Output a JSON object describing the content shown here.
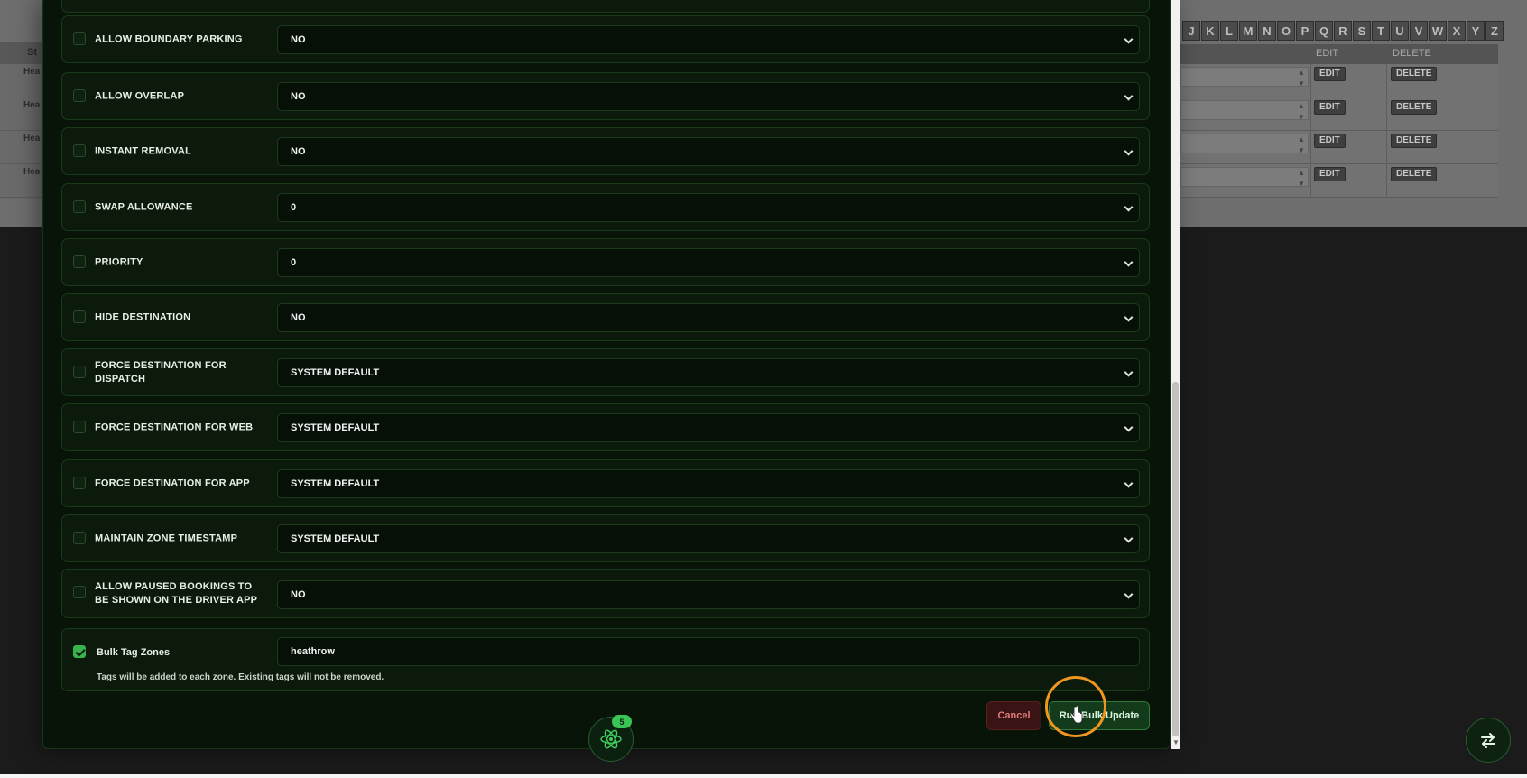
{
  "background": {
    "left_header_fragment": "St",
    "left_cells": [
      "Hea",
      "Hea",
      "Hea",
      "Hea"
    ],
    "alphabet": [
      "J",
      "K",
      "L",
      "M",
      "N",
      "O",
      "P",
      "Q",
      "R",
      "S",
      "T",
      "U",
      "V",
      "W",
      "X",
      "Y",
      "Z"
    ],
    "headers": {
      "edit": "EDIT",
      "delete": "DELETE"
    },
    "rows": [
      {
        "edit": "EDIT",
        "delete": "DELETE"
      },
      {
        "edit": "EDIT",
        "delete": "DELETE"
      },
      {
        "edit": "EDIT",
        "delete": "DELETE"
      },
      {
        "edit": "EDIT",
        "delete": "DELETE"
      }
    ]
  },
  "settings": [
    {
      "label": "ALLOW BOUNDARY PARKING",
      "value": "NO"
    },
    {
      "label": "ALLOW OVERLAP",
      "value": "NO"
    },
    {
      "label": "INSTANT REMOVAL",
      "value": "NO"
    },
    {
      "label": "SWAP ALLOWANCE",
      "value": "0"
    },
    {
      "label": "PRIORITY",
      "value": "0"
    },
    {
      "label": "HIDE DESTINATION",
      "value": "NO"
    },
    {
      "label": "FORCE DESTINATION FOR DISPATCH",
      "value": "SYSTEM DEFAULT"
    },
    {
      "label": "FORCE DESTINATION FOR WEB",
      "value": "SYSTEM DEFAULT"
    },
    {
      "label": "FORCE DESTINATION FOR APP",
      "value": "SYSTEM DEFAULT"
    },
    {
      "label": "MAINTAIN ZONE TIMESTAMP",
      "value": "SYSTEM DEFAULT"
    },
    {
      "label": "ALLOW PAUSED BOOKINGS TO BE SHOWN ON THE DRIVER APP",
      "value": "NO"
    }
  ],
  "bulk_tag": {
    "label": "Bulk Tag Zones",
    "value": "heathrow",
    "note": "Tags will be added to each zone. Existing tags will not be removed."
  },
  "actions": {
    "cancel": "Cancel",
    "run": "Run Bulk Update"
  },
  "fab": {
    "badge": "5"
  },
  "colors": {
    "accent": "#37b24d",
    "cancel": "#e27a7a",
    "highlight": "#f0951f"
  }
}
